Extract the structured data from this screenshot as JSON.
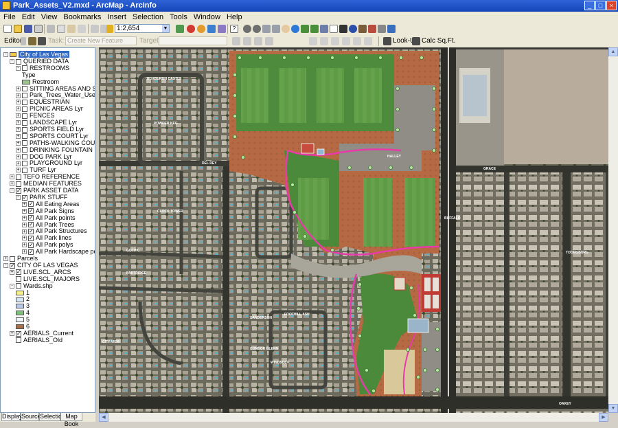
{
  "window": {
    "title": "Park_Assets_V2.mxd - ArcMap - ArcInfo",
    "buttons": [
      "_",
      "□",
      "×"
    ]
  },
  "menu": [
    "File",
    "Edit",
    "View",
    "Bookmarks",
    "Insert",
    "Selection",
    "Tools",
    "Window",
    "Help"
  ],
  "toolbar": {
    "scale_value": "1:2,654",
    "editor_label": "Editor",
    "task_label": "Task:",
    "task_value": "Create New Feature",
    "target_label": "Target:",
    "lookup_label": "Look-Up",
    "calc_label": "Calc Sq.Ft."
  },
  "toc": {
    "items": [
      {
        "label": "City of Las Vegas",
        "level": 0,
        "expander": "-",
        "selected": true
      },
      {
        "label": "QUERIED DATA",
        "level": 1,
        "expander": "-",
        "checked": false
      },
      {
        "label": "RESTROOMS",
        "level": 2,
        "expander": "-",
        "checked": false
      },
      {
        "label": "Type",
        "level": 3,
        "kind": "text"
      },
      {
        "label": "Restroom",
        "level": 3,
        "kind": "swatch",
        "color": "#9ec38f"
      },
      {
        "label": "SITTING AREAS AND SEATING",
        "level": 2,
        "expander": "+",
        "checked": false
      },
      {
        "label": "Park_Trees_Water_Use",
        "level": 2,
        "expander": "+",
        "checked": false
      },
      {
        "label": "EQUESTRIAN",
        "level": 2,
        "expander": "+",
        "checked": false
      },
      {
        "label": "PICNIC AREAS Lyr",
        "level": 2,
        "expander": "+",
        "checked": false
      },
      {
        "label": "FENCES",
        "level": 2,
        "expander": "+",
        "checked": false
      },
      {
        "label": "LANDSCAPE Lyr",
        "level": 2,
        "expander": "+",
        "checked": false
      },
      {
        "label": "SPORTS FIELD Lyr",
        "level": 2,
        "expander": "+",
        "checked": false
      },
      {
        "label": "SPORTS COURT Lyr",
        "level": 2,
        "expander": "+",
        "checked": false
      },
      {
        "label": "PATHS-WALKING COURSE Lyr",
        "level": 2,
        "expander": "+",
        "checked": false
      },
      {
        "label": "DRINKING FOUNTAIN Lyr",
        "level": 2,
        "expander": "+",
        "checked": false
      },
      {
        "label": "DOG PARK Lyr",
        "level": 2,
        "expander": "+",
        "checked": false
      },
      {
        "label": "PLAYGROUND Lyr",
        "level": 2,
        "expander": "+",
        "checked": false
      },
      {
        "label": "TURF Lyr",
        "level": 2,
        "expander": "+",
        "checked": false
      },
      {
        "label": "TEFO REFERENCE",
        "level": 1,
        "expander": "+",
        "checked": false
      },
      {
        "label": "MEDIAN FEATURES",
        "level": 1,
        "expander": "+",
        "checked": false
      },
      {
        "label": "PARK ASSET DATA",
        "level": 1,
        "expander": "-",
        "checked": true
      },
      {
        "label": "PARK STUFF",
        "level": 2,
        "expander": "-",
        "checked": true
      },
      {
        "label": "All Eating Areas",
        "level": 3,
        "expander": "+",
        "checked": true
      },
      {
        "label": "All Park Signs",
        "level": 3,
        "expander": "+",
        "checked": true
      },
      {
        "label": "All Park points",
        "level": 3,
        "expander": "+",
        "checked": true
      },
      {
        "label": "All Park Trees",
        "level": 3,
        "expander": "+",
        "checked": true
      },
      {
        "label": "All Park Structures",
        "level": 3,
        "expander": "+",
        "checked": true
      },
      {
        "label": "All Park lines",
        "level": 3,
        "expander": "+",
        "checked": true
      },
      {
        "label": "All Park polys",
        "level": 3,
        "expander": "+",
        "checked": true
      },
      {
        "label": "All Park Hardscape polys",
        "level": 3,
        "expander": "+",
        "checked": true
      },
      {
        "label": "Parcels",
        "level": 0,
        "expander": "+",
        "checked": false
      },
      {
        "label": "CITY OF LAS VEGAS",
        "level": 0,
        "expander": "-",
        "checked": true
      },
      {
        "label": "LIVE.SCL_ARCS",
        "level": 1,
        "expander": "+",
        "checked": true
      },
      {
        "label": "LIVE.SCL_MAJORS",
        "level": 1,
        "expander": "",
        "checked": false
      },
      {
        "label": "Wards.shp",
        "level": 1,
        "expander": "-",
        "checked": false
      },
      {
        "label": "1",
        "level": 2,
        "kind": "swatch",
        "color": "#f6f08a"
      },
      {
        "label": "2",
        "level": 2,
        "kind": "swatch",
        "color": "#d6e8f7"
      },
      {
        "label": "3",
        "level": 2,
        "kind": "swatch",
        "color": "#b9c7e8"
      },
      {
        "label": "4",
        "level": 2,
        "kind": "swatch",
        "color": "#7ec27a"
      },
      {
        "label": "5",
        "level": 2,
        "kind": "swatch",
        "color": "#eef4f7"
      },
      {
        "label": "6",
        "level": 2,
        "kind": "swatch",
        "color": "#a8704a"
      },
      {
        "label": "AERIALS_Current",
        "level": 1,
        "expander": "+",
        "checked": true
      },
      {
        "label": "AERIALS_Old",
        "level": 1,
        "expander": "",
        "checked": false
      }
    ]
  },
  "toc_tabs": [
    "Display",
    "Source",
    "Selection",
    "Map Book"
  ],
  "map": {
    "street_labels": [
      "ROXBURGH CASTLE",
      "POWDER KEG",
      "CLOCK TOWER",
      "GOTHIC",
      "DEL REY",
      "FOOTHILL ASH",
      "CITY VIEW",
      "SANDERSON",
      "OAKEY",
      "CONDOR GLENN",
      "WINDSOCK",
      "HALLEY",
      "BUFFALO",
      "TOOMSBURG",
      "GRACE",
      "PARTRIDGE"
    ]
  }
}
